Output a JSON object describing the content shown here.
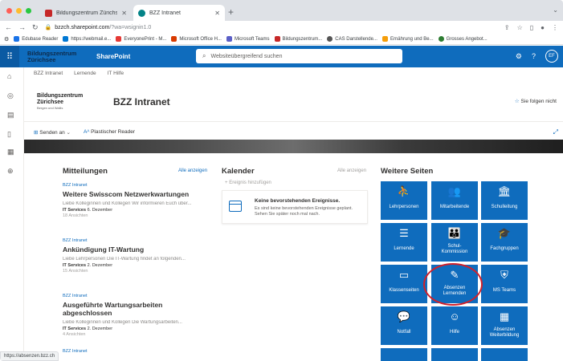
{
  "browser": {
    "tabs": [
      {
        "title": "Bildungszentrum Zürichsee: G"
      },
      {
        "title": "BZZ Intranet"
      }
    ],
    "url_host": "bzzch.sharepoint.com",
    "url_path": "/?wa=wsignin1.0",
    "new_tab_symbol": "+",
    "bookmarks": [
      {
        "label": "Edubase Reader",
        "color": "#1a73e8"
      },
      {
        "label": "https://webmail.e...",
        "color": "#0078d4"
      },
      {
        "label": "EveryonePrint - M...",
        "color": "#e53935"
      },
      {
        "label": "Microsoft Office H...",
        "color": "#d83b01"
      },
      {
        "label": "Microsoft Teams",
        "color": "#5b5fc7"
      },
      {
        "label": "Bildungszentrum...",
        "color": "#c62828"
      },
      {
        "label": "CAS Darstellende...",
        "color": "#555555"
      },
      {
        "label": "Ernährung und Be...",
        "color": "#f59e0b"
      },
      {
        "label": "Grosses Angebot...",
        "color": "#2e7d32"
      }
    ]
  },
  "suite_bar": {
    "logo_line1": "Bildungszentrum",
    "logo_line2": "Zürichsee",
    "app_name": "SharePoint",
    "search_placeholder": "Websiteübergreifend suchen",
    "avatar_initials": "EF"
  },
  "breadcrumb": [
    "BZZ Intranet",
    "Lernende",
    "IT Hilfe"
  ],
  "site": {
    "logo_line1": "Bildungszentrum",
    "logo_line2": "Zürichsee",
    "logo_line3": "Bergen und Wallis",
    "title": "BZZ Intranet",
    "follow_label": "Sie folgen nicht"
  },
  "commands": {
    "send_label": "Senden an",
    "reader_label": "Plastischer Reader"
  },
  "news": {
    "heading": "Mitteilungen",
    "see_all": "Alle anzeigen",
    "items": [
      {
        "source": "BZZ Intranet",
        "title": "Weitere Swisscom Netzwerkwartungen",
        "desc": "Liebe Kolleginnen und Kollegen Wir informieren Euch über...",
        "author": "IT Services",
        "date": "6. Dezember",
        "views": "18 Ansichten"
      },
      {
        "source": "BZZ Intranet",
        "title": "Ankündigung IT-Wartung",
        "desc": "Liebe Lehrpersonen Die IT-Wartung findet an folgenden...",
        "author": "IT Services",
        "date": "2. Dezember",
        "views": "15 Ansichten"
      },
      {
        "source": "BZZ Intranet",
        "title": "Ausgeführte Wartungsarbeiten abgeschlossen",
        "desc": "Liebe Kolleginnen und Kollegen Die Wartungsarbeiten...",
        "author": "IT Services",
        "date": "2. Dezember",
        "views": "4 Ansichten"
      },
      {
        "source": "BZZ Intranet"
      }
    ]
  },
  "calendar": {
    "heading": "Kalender",
    "see_all": "Alle anzeigen",
    "add_event": "Ereignis hinzufügen",
    "empty_title": "Keine bevorstehenden Ereignisse.",
    "empty_desc": "Es sind keine bevorstehenden Ereignisse geplant. Sehen Sie später noch mal nach."
  },
  "more_pages": {
    "heading": "Weitere Seiten",
    "tiles": [
      {
        "label": "Lehrpersonen",
        "icon": "teacher-icon",
        "glyph": "⛹"
      },
      {
        "label": "Mitarbeitende",
        "icon": "staff-icon",
        "glyph": "👥"
      },
      {
        "label": "Schulleitung",
        "icon": "building-icon",
        "glyph": "🏛"
      },
      {
        "label": "Lernende",
        "icon": "students-icon",
        "glyph": "☰"
      },
      {
        "label": "Schul- Kommission",
        "icon": "commission-icon",
        "glyph": "👪"
      },
      {
        "label": "Fachgruppen",
        "icon": "graduation-icon",
        "glyph": "🎓"
      },
      {
        "label": "Klassenseiten",
        "icon": "class-page-icon",
        "glyph": "▭"
      },
      {
        "label": "Absenzen Lernenden",
        "icon": "absence-icon",
        "glyph": "✎"
      },
      {
        "label": "MS Teams",
        "icon": "teams-icon",
        "glyph": "⛨"
      },
      {
        "label": "Notfall",
        "icon": "chat-icon",
        "glyph": "💬"
      },
      {
        "label": "Hilfe",
        "icon": "help-icon",
        "glyph": "☺"
      },
      {
        "label": "Absenzen Weiterbildung",
        "icon": "calendar-icon",
        "glyph": "▦"
      }
    ]
  },
  "status_url": "https://absenzen.bzz.ch"
}
